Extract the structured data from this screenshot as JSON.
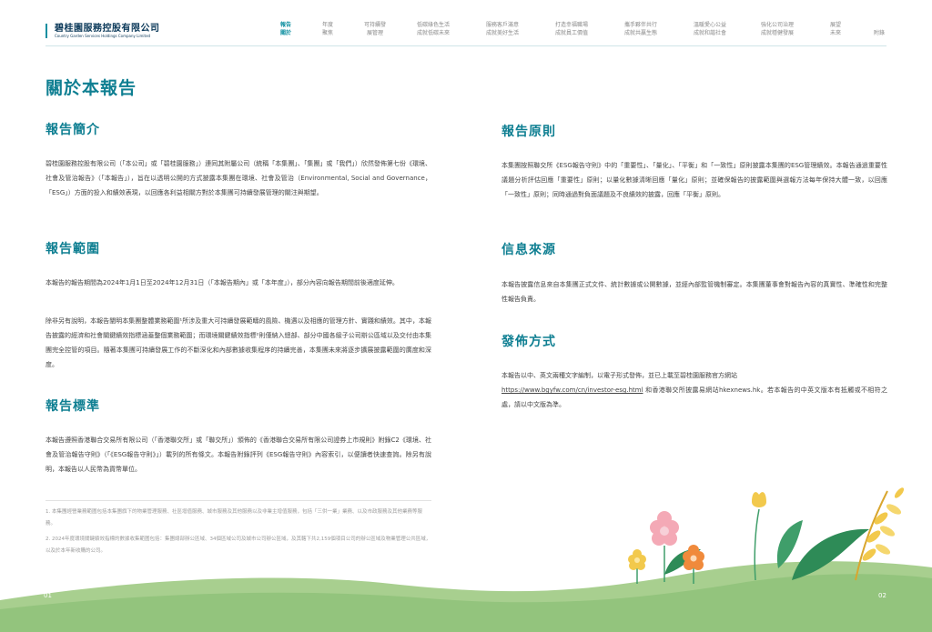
{
  "header": {
    "logo_cn": "碧桂園服務控股有限公司",
    "logo_en": "Country Garden Services Holdings Company Limited",
    "nav": [
      {
        "label": "報告\n關於",
        "active": true
      },
      {
        "label": "年度\n聚焦",
        "active": false
      },
      {
        "label": "可持續發\n展管理",
        "active": false
      },
      {
        "label": "低碳綠色生活\n成就低碳未來",
        "active": false
      },
      {
        "label": "服務客戶滿意\n成就美好生活",
        "active": false
      },
      {
        "label": "打造幸福職場\n成就員工價值",
        "active": false
      },
      {
        "label": "攜手夥伴共行\n成就共贏生態",
        "active": false
      },
      {
        "label": "溫暖愛心公益\n成就和諧社會",
        "active": false
      },
      {
        "label": "強化公司治理\n成就穩健發展",
        "active": false
      },
      {
        "label": "展望\n未來",
        "active": false
      },
      {
        "label": "附錄",
        "active": false
      }
    ]
  },
  "page_title": "關於本報告",
  "left": {
    "intro": {
      "heading": "報告簡介",
      "text": "碧桂園服務控股有限公司（「本公司」或「碧桂園服務」）連同其附屬公司（統稱「本集團」、「集團」或「我們」）欣然發佈第七份《環境、社會及管治報告》（「本報告」），旨在以透明公開的方式披露本集團在環境、社會及管治（Environmental, Social and Governance，「ESG」）方面的投入和績效表現，以回應各利益相關方對於本集團可持續發展管理的關注與期望。"
    },
    "scope": {
      "heading": "報告範圍",
      "text1": "本報告的報告期間為2024年1月1日至2024年12月31日（「本報告期內」或「本年度」），部分內容向報告期間前後適度延伸。",
      "text2": "除非另有說明，本報告闡明本集團整體業務範圍¹所涉及重大可持續發展範疇的風險、機遇以及相應的管理方針、實踐和績效。其中，本報告披露的經濟和社會關鍵績效指標涵蓋整個業務範圍；而環境關鍵績效指標²則僅納入總部、部分中國各級子公司辦公區域以及交付由本集團完全控管的項目。隨著本集團可持續發展工作的不斷深化和內部數據收集程序的持續完善，本集團未來將逐步擴展披露範圍的廣度和深度。"
    },
    "standard": {
      "heading": "報告標準",
      "text": "本報告遵照香港聯合交易所有限公司（「香港聯交所」或「聯交所」）頒佈的《香港聯合交易所有限公司證券上市規則》附錄C2《環境、社會及管治報告守則》（「《ESG報告守則》」）載列的所有條文。本報告附錄評列《ESG報告守則》內容索引，以便讀者快速查詢。除另有說明，本報告以人民幣為貨幣單位。"
    },
    "footnotes": [
      "1. 本集團經營業務範圍包括本集團旗下的物業管理服務、社區增值服務、城市服務及其他服務以及非業主增值服務，包括「三供一業」業務、以及市政服務及其他業務等服務。",
      "2. 2024年度環境關鍵績效指標的數據收集範圍包括：集團總部辦公區域、34個區域公司及城市公司辦公區域，及其轄下共2,159個項目公司的辦公區域及物業管理公共區域，以及於本年新收購的公司。"
    ],
    "page_number": "01"
  },
  "right": {
    "principles": {
      "heading": "報告原則",
      "text": "本集團按照聯交所《ESG報告守則》中的「重要性」、「量化」、「平衡」和「一致性」原則披露本集團的ESG管理績效。本報告通過重要性議題分析評估回應「重要性」原則；以量化數據清晰回應「量化」原則；並確保報告的披露範圍與選報方法每年保持大體一致，以回應「一致性」原則；同時通過對負面議題及不良績效的披露，回應「平衡」原則。"
    },
    "sources": {
      "heading": "信息來源",
      "text": "本報告披露信息來自本集團正式文件、統計數據或公開數據，並經內部監管機制審定。本集團董事會對報告內容的真實性、準確性和完整性報告負責。"
    },
    "publish": {
      "heading": "發佈方式",
      "text_before": "本報告以中、英文兩種文字編制，以電子形式發佈，並已上載至碧桂園服務官方網站",
      "link": "https://www.bgyfw.com/cn/investor-esg.html",
      "text_after": " 和香港聯交所披露易網站hkexnews.hk。若本報告的中英文版本有抵觸或不相符之處，請以中文版為準。"
    },
    "page_number": "02"
  },
  "colors": {
    "accent": "#0f7f92",
    "ground_green": "#93c47d",
    "leaf_dark": "#2e8b57",
    "leaf_yellow": "#f2c94c",
    "flower_pink": "#f4a9b6",
    "flower_orange": "#f08a3c"
  }
}
